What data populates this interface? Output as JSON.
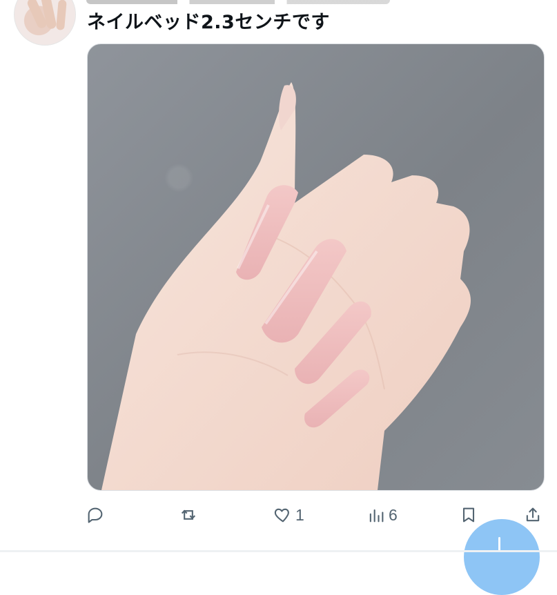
{
  "tweet": {
    "text": "ネイルベッド2.3センチです"
  },
  "actions": {
    "reply_count": "",
    "retweet_count": "",
    "like_count": "1",
    "views_count": "6"
  },
  "icons": {
    "reply": "reply-icon",
    "retweet": "retweet-icon",
    "like": "heart-icon",
    "views": "views-icon",
    "bookmark": "bookmark-icon",
    "share": "share-icon",
    "compose": "compose-icon"
  },
  "colors": {
    "action_gray": "#536471",
    "fab_blue": "#8ec5f5"
  }
}
